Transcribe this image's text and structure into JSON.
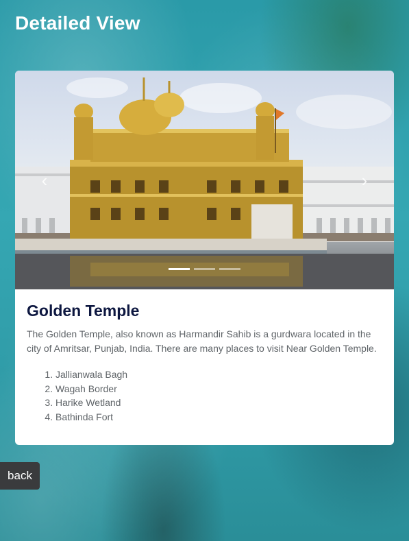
{
  "header": {
    "title": "Detailed View"
  },
  "carousel": {
    "prev_symbol": "‹",
    "next_symbol": "›",
    "slide_count": 3,
    "active_index": 0
  },
  "place": {
    "title": "Golden Temple",
    "description": "The Golden Temple, also known as Harmandir Sahib is a gurdwara located in the city of Amritsar, Punjab, India. There are many places to visit Near Golden Temple.",
    "nearby": [
      "Jallianwala Bagh",
      "Wagah Border",
      "Harike Wetland",
      "Bathinda Fort"
    ]
  },
  "footer": {
    "back_label": "back"
  },
  "colors": {
    "title": "#0d1740",
    "body_text": "#5f6468",
    "back_button": "#3a3b3d",
    "background": "#2f9aa6"
  }
}
